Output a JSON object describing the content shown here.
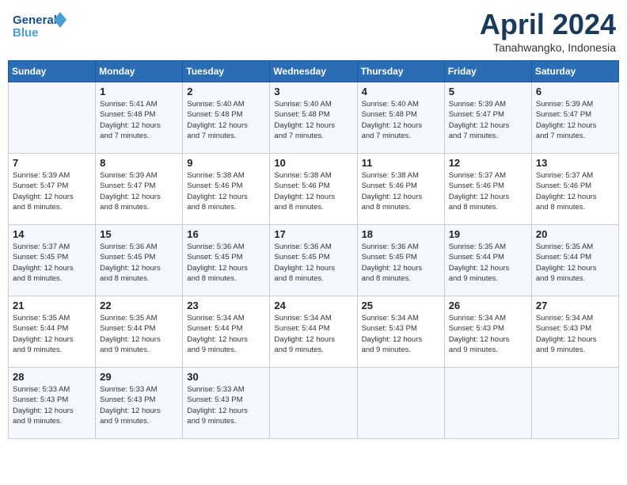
{
  "header": {
    "logo_line1": "General",
    "logo_line2": "Blue",
    "month": "April 2024",
    "location": "Tanahwangko, Indonesia"
  },
  "days_of_week": [
    "Sunday",
    "Monday",
    "Tuesday",
    "Wednesday",
    "Thursday",
    "Friday",
    "Saturday"
  ],
  "weeks": [
    [
      {
        "day": "",
        "info": ""
      },
      {
        "day": "1",
        "info": "Sunrise: 5:41 AM\nSunset: 5:48 PM\nDaylight: 12 hours\nand 7 minutes."
      },
      {
        "day": "2",
        "info": "Sunrise: 5:40 AM\nSunset: 5:48 PM\nDaylight: 12 hours\nand 7 minutes."
      },
      {
        "day": "3",
        "info": "Sunrise: 5:40 AM\nSunset: 5:48 PM\nDaylight: 12 hours\nand 7 minutes."
      },
      {
        "day": "4",
        "info": "Sunrise: 5:40 AM\nSunset: 5:48 PM\nDaylight: 12 hours\nand 7 minutes."
      },
      {
        "day": "5",
        "info": "Sunrise: 5:39 AM\nSunset: 5:47 PM\nDaylight: 12 hours\nand 7 minutes."
      },
      {
        "day": "6",
        "info": "Sunrise: 5:39 AM\nSunset: 5:47 PM\nDaylight: 12 hours\nand 7 minutes."
      }
    ],
    [
      {
        "day": "7",
        "info": "Sunrise: 5:39 AM\nSunset: 5:47 PM\nDaylight: 12 hours\nand 8 minutes."
      },
      {
        "day": "8",
        "info": "Sunrise: 5:39 AM\nSunset: 5:47 PM\nDaylight: 12 hours\nand 8 minutes."
      },
      {
        "day": "9",
        "info": "Sunrise: 5:38 AM\nSunset: 5:46 PM\nDaylight: 12 hours\nand 8 minutes."
      },
      {
        "day": "10",
        "info": "Sunrise: 5:38 AM\nSunset: 5:46 PM\nDaylight: 12 hours\nand 8 minutes."
      },
      {
        "day": "11",
        "info": "Sunrise: 5:38 AM\nSunset: 5:46 PM\nDaylight: 12 hours\nand 8 minutes."
      },
      {
        "day": "12",
        "info": "Sunrise: 5:37 AM\nSunset: 5:46 PM\nDaylight: 12 hours\nand 8 minutes."
      },
      {
        "day": "13",
        "info": "Sunrise: 5:37 AM\nSunset: 5:46 PM\nDaylight: 12 hours\nand 8 minutes."
      }
    ],
    [
      {
        "day": "14",
        "info": "Sunrise: 5:37 AM\nSunset: 5:45 PM\nDaylight: 12 hours\nand 8 minutes."
      },
      {
        "day": "15",
        "info": "Sunrise: 5:36 AM\nSunset: 5:45 PM\nDaylight: 12 hours\nand 8 minutes."
      },
      {
        "day": "16",
        "info": "Sunrise: 5:36 AM\nSunset: 5:45 PM\nDaylight: 12 hours\nand 8 minutes."
      },
      {
        "day": "17",
        "info": "Sunrise: 5:36 AM\nSunset: 5:45 PM\nDaylight: 12 hours\nand 8 minutes."
      },
      {
        "day": "18",
        "info": "Sunrise: 5:36 AM\nSunset: 5:45 PM\nDaylight: 12 hours\nand 8 minutes."
      },
      {
        "day": "19",
        "info": "Sunrise: 5:35 AM\nSunset: 5:44 PM\nDaylight: 12 hours\nand 9 minutes."
      },
      {
        "day": "20",
        "info": "Sunrise: 5:35 AM\nSunset: 5:44 PM\nDaylight: 12 hours\nand 9 minutes."
      }
    ],
    [
      {
        "day": "21",
        "info": "Sunrise: 5:35 AM\nSunset: 5:44 PM\nDaylight: 12 hours\nand 9 minutes."
      },
      {
        "day": "22",
        "info": "Sunrise: 5:35 AM\nSunset: 5:44 PM\nDaylight: 12 hours\nand 9 minutes."
      },
      {
        "day": "23",
        "info": "Sunrise: 5:34 AM\nSunset: 5:44 PM\nDaylight: 12 hours\nand 9 minutes."
      },
      {
        "day": "24",
        "info": "Sunrise: 5:34 AM\nSunset: 5:44 PM\nDaylight: 12 hours\nand 9 minutes."
      },
      {
        "day": "25",
        "info": "Sunrise: 5:34 AM\nSunset: 5:43 PM\nDaylight: 12 hours\nand 9 minutes."
      },
      {
        "day": "26",
        "info": "Sunrise: 5:34 AM\nSunset: 5:43 PM\nDaylight: 12 hours\nand 9 minutes."
      },
      {
        "day": "27",
        "info": "Sunrise: 5:34 AM\nSunset: 5:43 PM\nDaylight: 12 hours\nand 9 minutes."
      }
    ],
    [
      {
        "day": "28",
        "info": "Sunrise: 5:33 AM\nSunset: 5:43 PM\nDaylight: 12 hours\nand 9 minutes."
      },
      {
        "day": "29",
        "info": "Sunrise: 5:33 AM\nSunset: 5:43 PM\nDaylight: 12 hours\nand 9 minutes."
      },
      {
        "day": "30",
        "info": "Sunrise: 5:33 AM\nSunset: 5:43 PM\nDaylight: 12 hours\nand 9 minutes."
      },
      {
        "day": "",
        "info": ""
      },
      {
        "day": "",
        "info": ""
      },
      {
        "day": "",
        "info": ""
      },
      {
        "day": "",
        "info": ""
      }
    ]
  ]
}
